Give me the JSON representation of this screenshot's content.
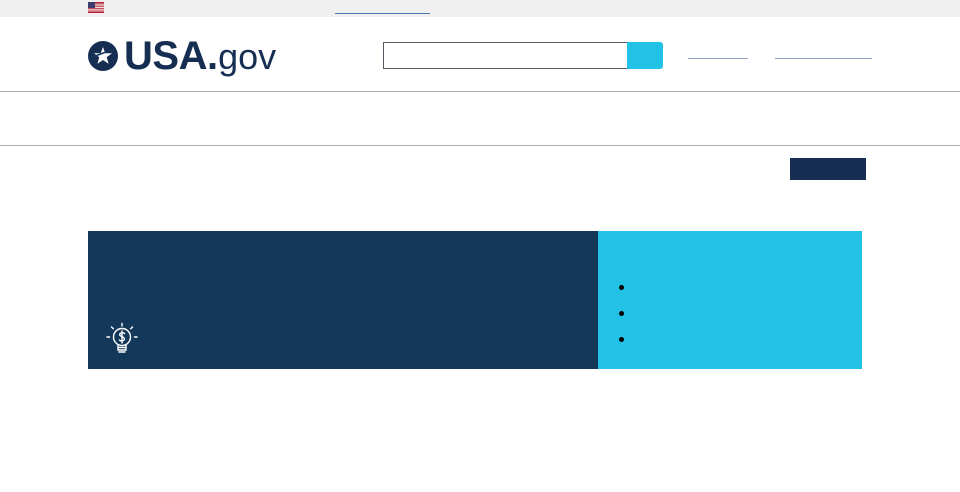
{
  "gov_banner": {
    "flag_icon": "us-flag-icon",
    "link_text": ""
  },
  "header": {
    "logo": {
      "badge_icon": "star-circle-icon",
      "usa": "USA",
      "dot": ".",
      "gov": "gov"
    },
    "search": {
      "value": "",
      "placeholder": "",
      "button_label": ""
    },
    "nav_links": [
      "",
      ""
    ]
  },
  "action_button": {
    "label": ""
  },
  "hero": {
    "icon": "lightbulb-dollar-icon",
    "list_items": [
      "",
      "",
      ""
    ]
  },
  "colors": {
    "navy": "#162e51",
    "hero_navy": "#14385a",
    "cyan": "#22c1e6",
    "banner_gray": "#f0f0f0"
  }
}
